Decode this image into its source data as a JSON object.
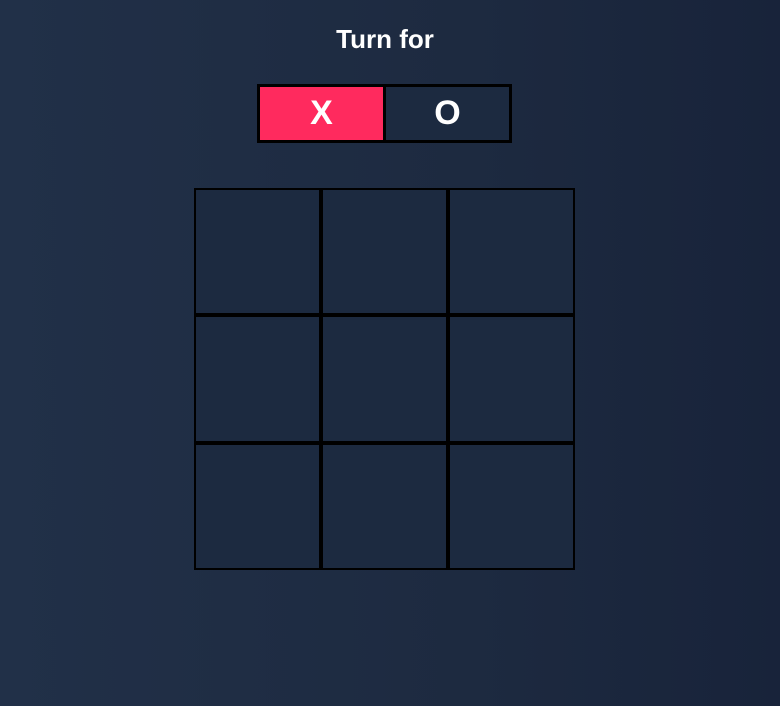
{
  "header": {
    "title": "Turn for"
  },
  "turn_selector": {
    "options": [
      {
        "label": "X",
        "active": true
      },
      {
        "label": "O",
        "active": false
      }
    ],
    "active_color": "#ff2a5e",
    "inactive_color": "#1c2a40"
  },
  "board": {
    "cells": [
      "",
      "",
      "",
      "",
      "",
      "",
      "",
      "",
      ""
    ]
  }
}
